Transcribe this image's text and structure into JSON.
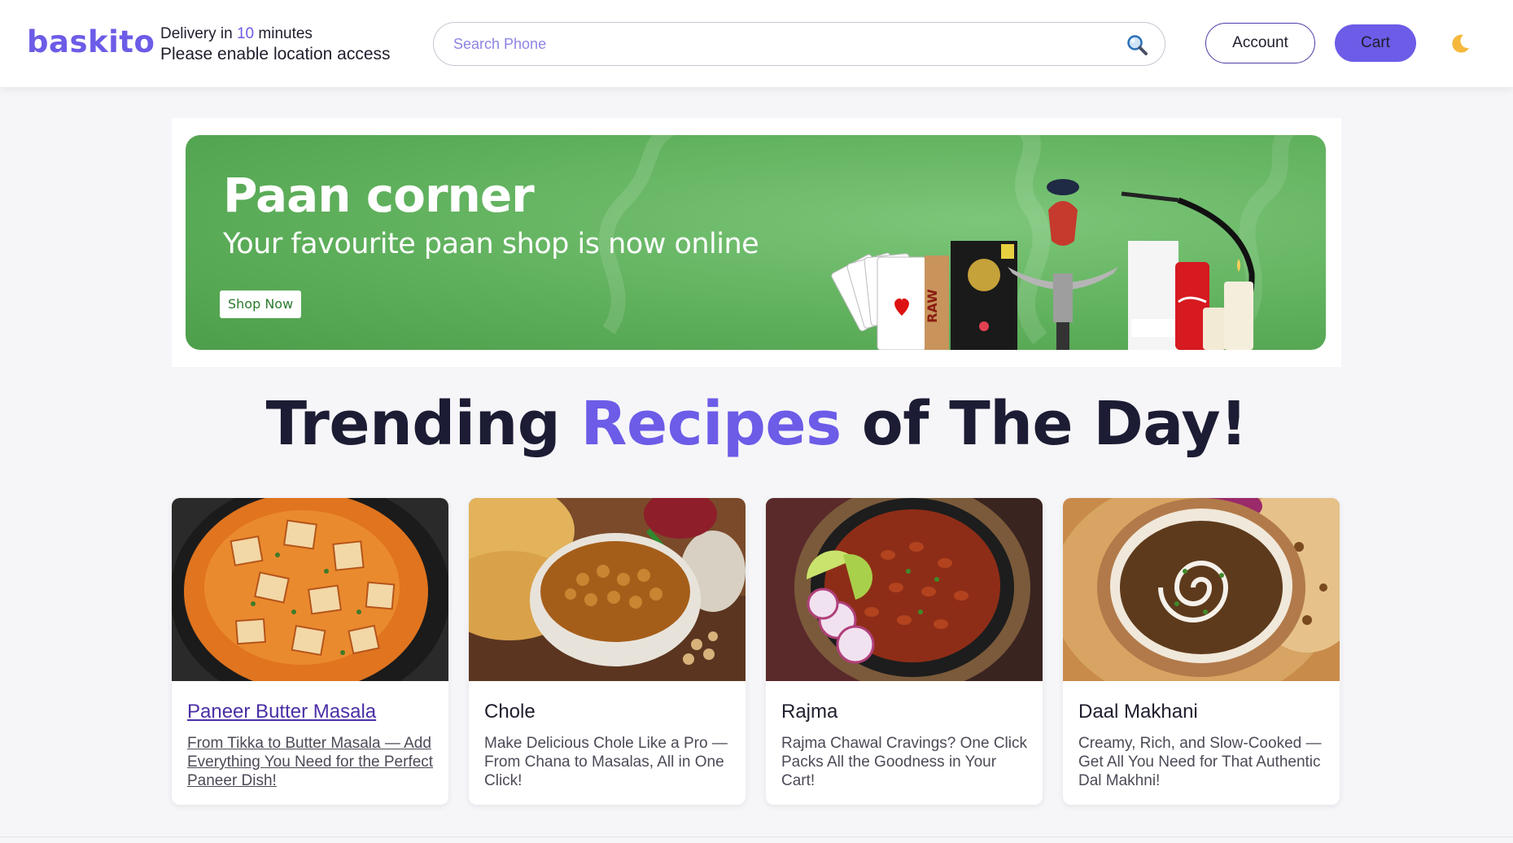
{
  "header": {
    "logo": "baskito",
    "delivery_prefix": "Delivery in ",
    "delivery_minutes": "10",
    "delivery_suffix": " minutes",
    "location_notice": "Please enable location access",
    "search_placeholder": "Search Phone",
    "account_label": "Account",
    "cart_label": "Cart"
  },
  "banner": {
    "title": "Paan corner",
    "subtitle": "Your favourite paan shop is now online",
    "cta": "Shop Now"
  },
  "trending": {
    "title_part1": "Trending ",
    "title_accent": "Recipes",
    "title_part2": " of The Day!"
  },
  "recipes": [
    {
      "title": "Paneer Butter Masala",
      "description": "From Tikka to Butter Masala — Add Everything You Need for the Perfect Paneer Dish!"
    },
    {
      "title": "Chole",
      "description": "Make Delicious Chole Like a Pro — From Chana to Masalas, All in One Click!"
    },
    {
      "title": "Rajma",
      "description": "Rajma Chawal Cravings? One Click Packs All the Goodness in Your Cart!"
    },
    {
      "title": "Daal Makhani",
      "description": "Creamy, Rich, and Slow-Cooked — Get All You Need for That Authentic Dal Makhni!"
    }
  ],
  "colors": {
    "accent": "#6c5ce7",
    "banner_green": "#5fb05c",
    "background": "#f6f6f9"
  },
  "icons": [
    "search-icon",
    "moon-icon"
  ]
}
